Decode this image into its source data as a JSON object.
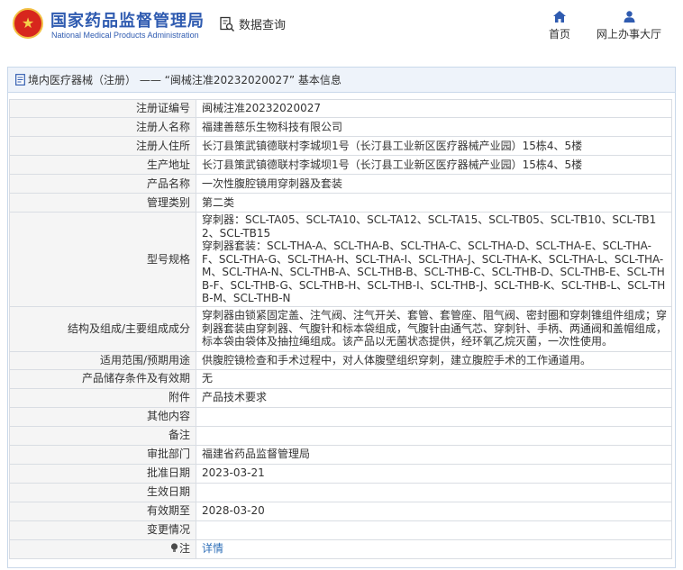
{
  "header": {
    "org_name_cn": "国家药品监督管理局",
    "org_name_en": "National Medical Products Administration",
    "query_label": "数据查询",
    "nav": {
      "home": "首页",
      "service_hall": "网上办事大厅"
    },
    "colors": {
      "brand": "#2f5bb0",
      "emblem_red": "#d7261d",
      "emblem_gold": "#f2c043"
    }
  },
  "panel": {
    "title": "境内医疗器械（注册） —— “闽械注准20232020027” 基本信息"
  },
  "rows": [
    {
      "label": "注册证编号",
      "value": "闽械注准20232020027"
    },
    {
      "label": "注册人名称",
      "value": "福建善慈乐生物科技有限公司"
    },
    {
      "label": "注册人住所",
      "value": "长汀县策武镇德联村李城坝1号（长汀县工业新区医疗器械产业园）15栋4、5楼"
    },
    {
      "label": "生产地址",
      "value": "长汀县策武镇德联村李城坝1号（长汀县工业新区医疗器械产业园）15栋4、5楼"
    },
    {
      "label": "产品名称",
      "value": "一次性腹腔镜用穿刺器及套装"
    },
    {
      "label": "管理类别",
      "value": "第二类"
    },
    {
      "label": "型号规格",
      "value_lines": [
        "穿刺器：SCL-TA05、SCL-TA10、SCL-TA12、SCL-TA15、SCL-TB05、SCL-TB10、SCL-TB12、SCL-TB15",
        "穿刺器套装：SCL-THA-A、SCL-THA-B、SCL-THA-C、SCL-THA-D、SCL-THA-E、SCL-THA-F、SCL-THA-G、SCL-THA-H、SCL-THA-I、SCL-THA-J、SCL-THA-K、SCL-THA-L、SCL-THA-M、SCL-THA-N、SCL-THB-A、SCL-THB-B、SCL-THB-C、SCL-THB-D、SCL-THB-E、SCL-THB-F、SCL-THB-G、SCL-THB-H、SCL-THB-I、SCL-THB-J、SCL-THB-K、SCL-THB-L、SCL-THB-M、SCL-THB-N"
      ]
    },
    {
      "label": "结构及组成/主要组成成分",
      "value": "穿刺器由锁紧固定盖、注气阀、注气开关、套管、套管座、阻气阀、密封圈和穿刺锥组件组成；穿刺器套装由穿刺器、气腹针和标本袋组成，气腹针由通气芯、穿刺针、手柄、两通阀和盖帽组成，标本袋由袋体及抽拉绳组成。该产品以无菌状态提供，经环氧乙烷灭菌，一次性使用。"
    },
    {
      "label": "适用范围/预期用途",
      "value": "供腹腔镜检查和手术过程中，对人体腹壁组织穿刺，建立腹腔手术的工作通道用。"
    },
    {
      "label": "产品储存条件及有效期",
      "value": "无"
    },
    {
      "label": "附件",
      "value": "产品技术要求"
    },
    {
      "label": "其他内容",
      "value": ""
    },
    {
      "label": "备注",
      "value": ""
    },
    {
      "label": "审批部门",
      "value": "福建省药品监督管理局"
    },
    {
      "label": "批准日期",
      "value": "2023-03-21"
    },
    {
      "label": "生效日期",
      "value": ""
    },
    {
      "label": "有效期至",
      "value": "2028-03-20"
    },
    {
      "label": "变更情况",
      "value": ""
    },
    {
      "label": "注",
      "value": "详情"
    }
  ]
}
